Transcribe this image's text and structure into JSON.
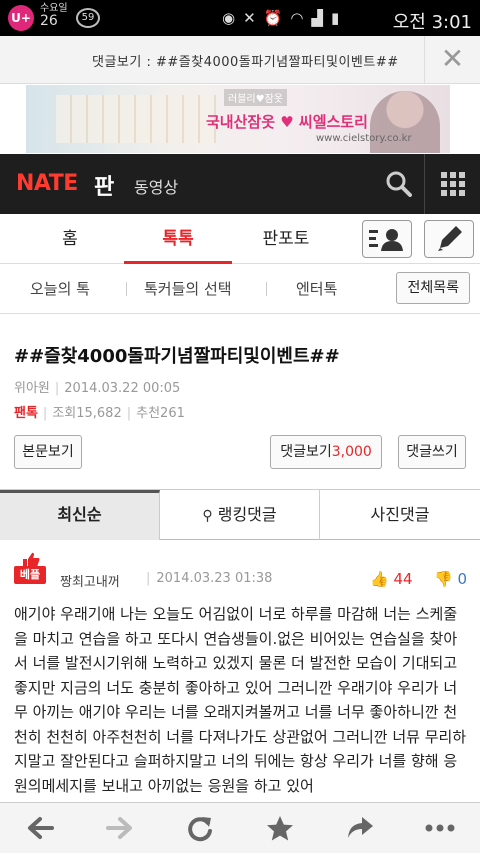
{
  "status_bar": {
    "carrier_line1": "수요일",
    "carrier_line2": "26",
    "notification_count": "59",
    "lg_label": "U+",
    "clock": "오전 3:01"
  },
  "comment_header": {
    "title": "댓글보기 : ##즐찾4000돌파기념짤파티및이벤트##"
  },
  "ad": {
    "brand": "러블리♥잠옷",
    "slogan": "국내산잠옷 ♥ 씨엘스토리",
    "url": "www.cielstory.co.kr"
  },
  "site_header": {
    "logo_prefix": "NATE",
    "logo_section": "판",
    "video_label": "동영상"
  },
  "tabs": [
    {
      "label": "홈"
    },
    {
      "label": "톡톡"
    },
    {
      "label": "판포토"
    }
  ],
  "subnav": {
    "items": [
      {
        "label": "오늘의 톡"
      },
      {
        "label": "톡커들의 선택"
      },
      {
        "label": "엔터톡"
      }
    ],
    "all_list_label": "전체목록"
  },
  "article": {
    "title": "##즐찾4000돌파기념짤파티및이벤트##",
    "author": "위아원",
    "date": "2014.03.22 00:05",
    "category": "팬톡",
    "views_label": "조회",
    "views": "15,682",
    "recommend_label": "추천",
    "recommend": "261",
    "view_body_label": "본문보기",
    "view_comments_label": "댓글보기",
    "comment_count": "3,000",
    "write_comment_label": "댓글쓰기"
  },
  "sort_tabs": [
    {
      "label": "최신순"
    },
    {
      "label": "랭킹댓글"
    },
    {
      "label": "사진댓글"
    }
  ],
  "comment": {
    "best_badge": "베플",
    "author": "짱최고내꺼",
    "date": "2014.03.23 01:38",
    "likes": "44",
    "dislikes": "0",
    "body": "애기야 우래기애 나는 오늘도 어김없이 너로 하루를 마감해 너는 스케줄을 마치고 연습을 하고 또다시 연습생들이.없은 비어있는 연습실을 찾아서 너를 발전시기위해 노력하고 있겠지 물론 더 발전한 모습이 기대되고 좋지만 지금의 너도 충분히 좋아하고 있어 그러니깐 우래기야 우리가 너무 아끼는 애기야 우리는 너를 오래지켜볼꺼고 너를 너무 좋아하니깐 천천히 천천히 아주천천히 너를 다져나가도 상관없어 그러니깐 너뮤 무리하지말고 잘안된다고 슬퍼하지말고 너의 뒤에는 항상 우리가 너를 향해 응원의메세지를 보내고 아끼없는 응원을 하고 있어"
  },
  "colors": {
    "accent": "#e8262a",
    "header_bg": "#1e1e1e",
    "dislike": "#3a7bbf"
  },
  "toolbar_icons": [
    "back-arrow-icon",
    "forward-arrow-icon",
    "refresh-icon",
    "star-icon",
    "share-icon",
    "more-icon"
  ]
}
